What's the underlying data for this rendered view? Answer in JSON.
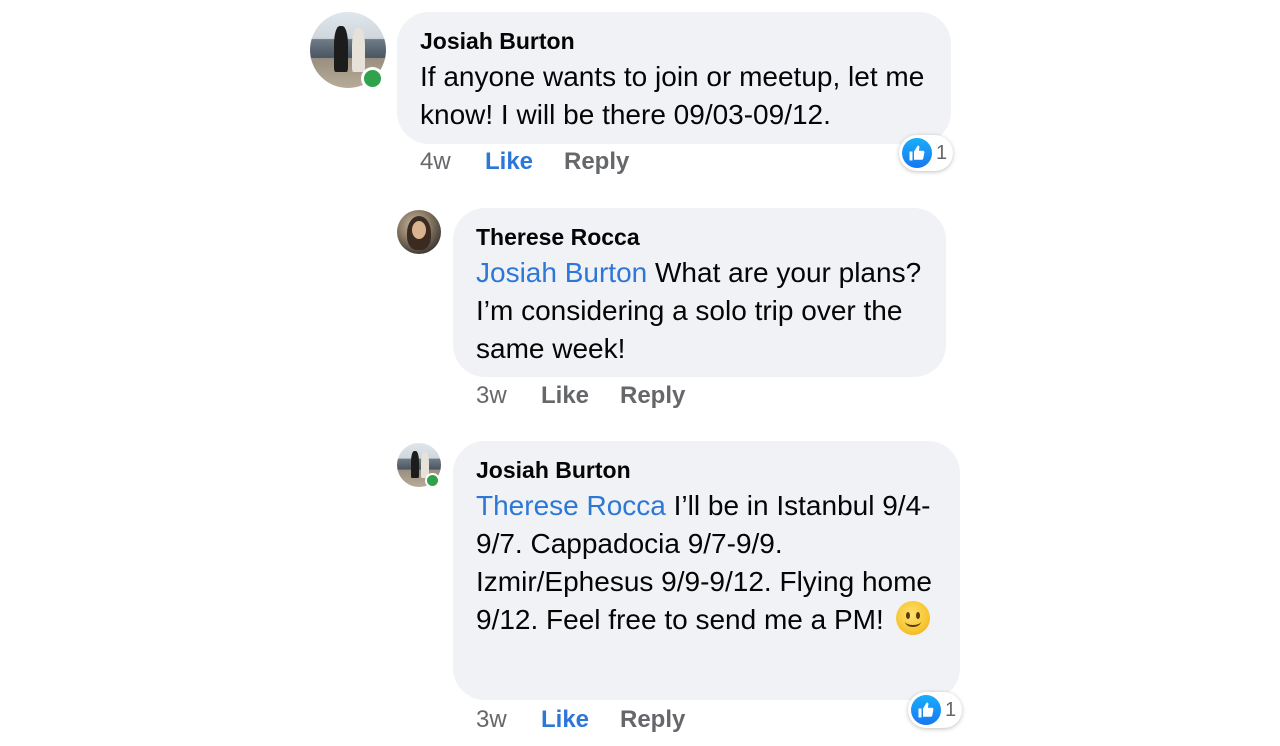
{
  "comments": [
    {
      "author": "Josiah Burton",
      "text": "If anyone wants to join or meetup, let me know! I will be there 09/03-09/12.",
      "time": "4w",
      "like_label": "Like",
      "reply_label": "Reply",
      "liked": true,
      "reaction_count": "1",
      "online": true
    },
    {
      "author": "Therese Rocca",
      "mention": "Josiah Burton",
      "text": " What are your plans? I’m considering a solo trip over the same week!",
      "time": "3w",
      "like_label": "Like",
      "reply_label": "Reply",
      "liked": false,
      "online": false
    },
    {
      "author": "Josiah Burton",
      "mention": "Therese Rocca",
      "text": " I’ll be in Istanbul 9/4-9/7. Cappadocia 9/7-9/9. Izmir/Ephesus 9/9-9/12. Flying home 9/12. Feel free to send me a PM! ",
      "emoji": "slightly-smiling-face",
      "time": "3w",
      "like_label": "Like",
      "reply_label": "Reply",
      "liked": true,
      "reaction_count": "1",
      "online": true
    }
  ],
  "colors": {
    "bubble": "#f0f2f5",
    "mention": "#2d78d6",
    "like_active": "#2d78d6",
    "meta": "#65676b",
    "online": "#31a24c"
  },
  "icons": {
    "reaction": "thumbs-up-icon",
    "emoji": "slightly-smiling-face-emoji"
  }
}
